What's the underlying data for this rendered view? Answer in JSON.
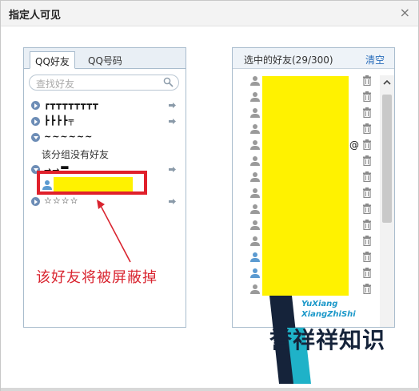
{
  "dialog": {
    "title": "指定人可见",
    "close_label": "×"
  },
  "left": {
    "tabs": [
      "QQ好友",
      "QQ号码"
    ],
    "search_placeholder": "查找好友",
    "groups": [
      {
        "name": "┏┳┳┳┳┳┳┳┳",
        "expanded": false
      },
      {
        "name": "┣┣┣┣╤",
        "expanded": false
      },
      {
        "name": "~~~~~~",
        "expanded": true
      },
      {
        "name": "→→〓",
        "expanded": true
      },
      {
        "name": "☆☆☆☆",
        "expanded": false
      }
    ],
    "empty_group_note": "该分组没有好友"
  },
  "annotation": "该好友将被屏蔽掉",
  "right": {
    "header": "选中的好友(29/300)",
    "clear_label": "清空",
    "at_symbol": "@"
  },
  "watermark": {
    "line1": "YuXiang",
    "line2": "XiangZhiShi",
    "text": "誉祥祥知识"
  },
  "colors": {
    "highlight": "#fff200",
    "annotation": "#d9242f",
    "accent": "#2a6ebb"
  }
}
